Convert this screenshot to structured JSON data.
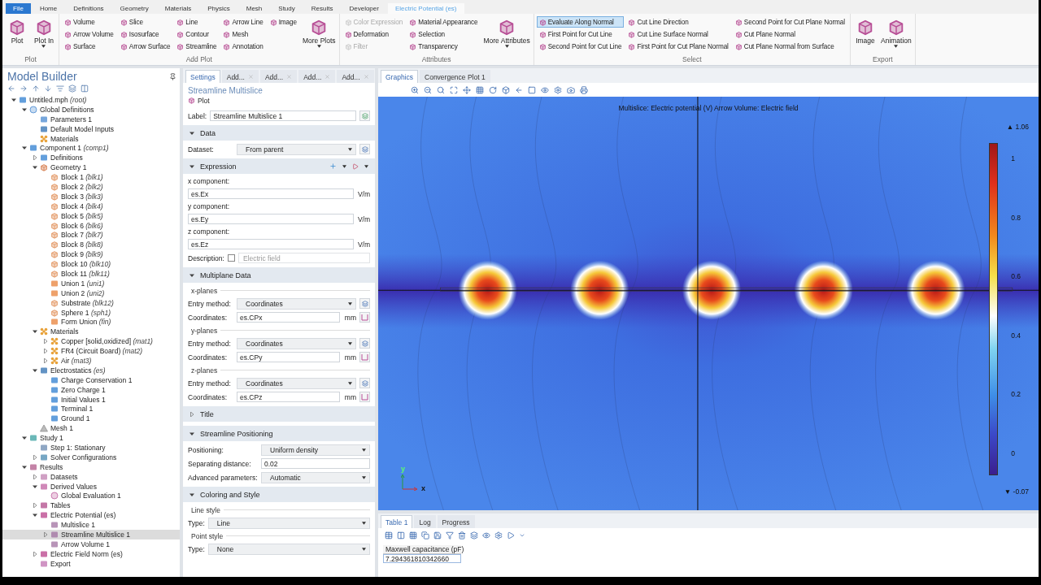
{
  "menu_tabs": [
    {
      "label": "File",
      "kind": "file"
    },
    {
      "label": "Home",
      "kind": "tab",
      "selected": false
    },
    {
      "label": "Definitions",
      "kind": "tab",
      "selected": false
    },
    {
      "label": "Geometry",
      "kind": "tab",
      "selected": false
    },
    {
      "label": "Materials",
      "kind": "tab",
      "selected": false
    },
    {
      "label": "Physics",
      "kind": "tab",
      "selected": false
    },
    {
      "label": "Mesh",
      "kind": "tab",
      "selected": false
    },
    {
      "label": "Study",
      "kind": "tab",
      "selected": false
    },
    {
      "label": "Results",
      "kind": "tab",
      "selected": false
    },
    {
      "label": "Developer",
      "kind": "tab",
      "selected": false
    },
    {
      "label": "Electric Potential (es)",
      "kind": "tab",
      "selected": true
    }
  ],
  "ribbon": [
    {
      "title": "Plot",
      "items": [
        {
          "label": "Plot",
          "kind": "large"
        },
        {
          "label": "Plot In",
          "kind": "large",
          "dropdown": true
        }
      ]
    },
    {
      "title": "Add Plot",
      "items": [
        {
          "label": "Volume",
          "kind": "small"
        },
        {
          "label": "Arrow Volume",
          "kind": "small"
        },
        {
          "label": "Surface",
          "kind": "small"
        },
        {
          "label": "Slice",
          "kind": "small"
        },
        {
          "label": "Isosurface",
          "kind": "small"
        },
        {
          "label": "Arrow Surface",
          "kind": "small"
        },
        {
          "label": "Line",
          "kind": "small"
        },
        {
          "label": "Contour",
          "kind": "small"
        },
        {
          "label": "Streamline",
          "kind": "small"
        },
        {
          "label": "Arrow Line",
          "kind": "small"
        },
        {
          "label": "Mesh",
          "kind": "small"
        },
        {
          "label": "Annotation",
          "kind": "small"
        },
        {
          "label": "Image",
          "kind": "small"
        },
        {
          "label": "More Plots",
          "kind": "large",
          "dropdown": true
        }
      ]
    },
    {
      "title": "Attributes",
      "items": [
        {
          "label": "Color Expression",
          "kind": "small",
          "disabled": true
        },
        {
          "label": "Deformation",
          "kind": "small"
        },
        {
          "label": "Filter",
          "kind": "small",
          "disabled": true
        },
        {
          "label": "Material Appearance",
          "kind": "small"
        },
        {
          "label": "Selection",
          "kind": "small"
        },
        {
          "label": "Transparency",
          "kind": "small"
        },
        {
          "label": "More Attributes",
          "kind": "large",
          "dropdown": true
        }
      ]
    },
    {
      "title": "Select",
      "items": [
        {
          "label": "Evaluate Along Normal",
          "kind": "small",
          "selected": true
        },
        {
          "label": "First Point for Cut Line",
          "kind": "small"
        },
        {
          "label": "Second Point for Cut Line",
          "kind": "small"
        },
        {
          "label": "Cut Line Direction",
          "kind": "small"
        },
        {
          "label": "Cut Line Surface Normal",
          "kind": "small"
        },
        {
          "label": "First Point for Cut Plane Normal",
          "kind": "small"
        },
        {
          "label": "Second Point for Cut Plane Normal",
          "kind": "small"
        },
        {
          "label": "Cut Plane Normal",
          "kind": "small"
        },
        {
          "label": "Cut Plane Normal from Surface",
          "kind": "small"
        }
      ]
    },
    {
      "title": "Export",
      "items": [
        {
          "label": "Image",
          "kind": "large"
        },
        {
          "label": "Animation",
          "kind": "large",
          "dropdown": true
        }
      ]
    }
  ],
  "model_builder": {
    "title": "Model Builder",
    "tree": [
      {
        "label": "Untitled.mph",
        "tag": "(root)",
        "kind": "file",
        "expanded": true,
        "selected": false,
        "children": [
          {
            "label": "Global Definitions",
            "kind": "global",
            "expanded": true,
            "selected": false,
            "children": [
              {
                "label": "Parameters 1",
                "kind": "param",
                "selected": false
              },
              {
                "label": "Default Model Inputs",
                "kind": "inputs",
                "selected": false
              },
              {
                "label": "Materials",
                "kind": "material",
                "selected": false
              }
            ]
          },
          {
            "label": "Component 1",
            "tag": "(comp1)",
            "kind": "component",
            "expanded": true,
            "selected": false,
            "children": [
              {
                "label": "Definitions",
                "kind": "definitions",
                "expanded": false,
                "selected": false
              },
              {
                "label": "Geometry 1",
                "kind": "geometry",
                "expanded": true,
                "selected": false,
                "children": [
                  {
                    "label": "Block 1",
                    "tag": "(blk1)",
                    "kind": "block",
                    "selected": false
                  },
                  {
                    "label": "Block 2",
                    "tag": "(blk2)",
                    "kind": "block",
                    "selected": false
                  },
                  {
                    "label": "Block 3",
                    "tag": "(blk3)",
                    "kind": "block",
                    "selected": false
                  },
                  {
                    "label": "Block 4",
                    "tag": "(blk4)",
                    "kind": "block",
                    "selected": false
                  },
                  {
                    "label": "Block 5",
                    "tag": "(blk5)",
                    "kind": "block",
                    "selected": false
                  },
                  {
                    "label": "Block 6",
                    "tag": "(blk6)",
                    "kind": "block",
                    "selected": false
                  },
                  {
                    "label": "Block 7",
                    "tag": "(blk7)",
                    "kind": "block",
                    "selected": false
                  },
                  {
                    "label": "Block 8",
                    "tag": "(blk8)",
                    "kind": "block",
                    "selected": false
                  },
                  {
                    "label": "Block 9",
                    "tag": "(blk9)",
                    "kind": "block",
                    "selected": false
                  },
                  {
                    "label": "Block 10",
                    "tag": "(blk10)",
                    "kind": "block",
                    "selected": false
                  },
                  {
                    "label": "Block 11",
                    "tag": "(blk11)",
                    "kind": "block",
                    "selected": false
                  },
                  {
                    "label": "Union 1",
                    "tag": "(uni1)",
                    "kind": "union",
                    "selected": false
                  },
                  {
                    "label": "Union 2",
                    "tag": "(uni2)",
                    "kind": "union",
                    "selected": false
                  },
                  {
                    "label": "Substrate",
                    "tag": "(blk12)",
                    "kind": "block",
                    "selected": false
                  },
                  {
                    "label": "Sphere 1",
                    "tag": "(sph1)",
                    "kind": "sphere",
                    "selected": false
                  },
                  {
                    "label": "Form Union",
                    "tag": "(fin)",
                    "kind": "union",
                    "selected": false
                  }
                ]
              },
              {
                "label": "Materials",
                "kind": "material",
                "expanded": true,
                "selected": false,
                "children": [
                  {
                    "label": "Copper [solid,oxidized]",
                    "tag": "(mat1)",
                    "kind": "material",
                    "expanded": false,
                    "selected": false
                  },
                  {
                    "label": "FR4 (Circuit Board)",
                    "tag": "(mat2)",
                    "kind": "material",
                    "expanded": false,
                    "selected": false
                  },
                  {
                    "label": "Air",
                    "tag": "(mat3)",
                    "kind": "material",
                    "expanded": false,
                    "selected": false
                  }
                ]
              },
              {
                "label": "Electrostatics",
                "tag": "(es)",
                "kind": "physics",
                "expanded": true,
                "selected": false,
                "children": [
                  {
                    "label": "Charge Conservation 1",
                    "kind": "feature",
                    "selected": false
                  },
                  {
                    "label": "Zero Charge 1",
                    "kind": "feature",
                    "selected": false
                  },
                  {
                    "label": "Initial Values 1",
                    "kind": "feature",
                    "selected": false
                  },
                  {
                    "label": "Terminal 1",
                    "kind": "feature",
                    "selected": false
                  },
                  {
                    "label": "Ground 1",
                    "kind": "feature",
                    "selected": false
                  }
                ]
              },
              {
                "label": "Mesh 1",
                "kind": "mesh",
                "selected": false
              }
            ]
          },
          {
            "label": "Study 1",
            "kind": "study",
            "expanded": true,
            "selected": false,
            "children": [
              {
                "label": "Step 1: Stationary",
                "kind": "step",
                "selected": false
              },
              {
                "label": "Solver Configurations",
                "kind": "solver",
                "expanded": false,
                "selected": false
              }
            ]
          },
          {
            "label": "Results",
            "kind": "results",
            "expanded": true,
            "selected": false,
            "children": [
              {
                "label": "Datasets",
                "kind": "dataset",
                "expanded": false,
                "selected": false
              },
              {
                "label": "Derived Values",
                "kind": "derived",
                "expanded": true,
                "selected": false,
                "children": [
                  {
                    "label": "Global Evaluation 1",
                    "kind": "eval",
                    "selected": false
                  }
                ]
              },
              {
                "label": "Tables",
                "kind": "table",
                "expanded": false,
                "selected": false
              },
              {
                "label": "Electric Potential (es)",
                "kind": "plotgroup",
                "expanded": true,
                "selected": false,
                "children": [
                  {
                    "label": "Multislice 1",
                    "kind": "plot",
                    "selected": false
                  },
                  {
                    "label": "Streamline Multislice 1",
                    "kind": "plot",
                    "expanded": false,
                    "selected": true
                  },
                  {
                    "label": "Arrow Volume 1",
                    "kind": "plot",
                    "selected": false
                  }
                ]
              },
              {
                "label": "Electric Field Norm (es)",
                "kind": "plotgroup",
                "expanded": false,
                "selected": false
              },
              {
                "label": "Export",
                "kind": "export",
                "selected": false
              }
            ]
          }
        ]
      }
    ]
  },
  "settings": {
    "tabs": [
      {
        "label": "Settings",
        "closable": false,
        "selected": true
      },
      {
        "label": "Add...",
        "closable": true,
        "selected": false
      },
      {
        "label": "Add...",
        "closable": true,
        "selected": false
      },
      {
        "label": "Add...",
        "closable": true,
        "selected": false
      },
      {
        "label": "Add...",
        "closable": true,
        "selected": false
      }
    ],
    "title": "Streamline Multislice",
    "subtitle": "Plot",
    "label_field": {
      "label": "Label:",
      "value": "Streamline Multislice 1"
    },
    "sections": [
      {
        "title": "Data",
        "expanded": true,
        "rows": [
          {
            "kind": "select",
            "label": "Dataset:",
            "value": "From parent"
          }
        ]
      },
      {
        "title": "Expression",
        "expanded": true,
        "rows": [
          {
            "kind": "stacked",
            "label": "x component:",
            "value": "es.Ex",
            "unit": "V/m"
          },
          {
            "kind": "stacked",
            "label": "y component:",
            "value": "es.Ey",
            "unit": "V/m"
          },
          {
            "kind": "stacked",
            "label": "z component:",
            "value": "es.Ez",
            "unit": "V/m"
          },
          {
            "kind": "checkbox",
            "label": "Description:",
            "checked": false,
            "placeholder": "Electric field"
          }
        ]
      },
      {
        "title": "Multiplane Data",
        "expanded": true,
        "rows": [
          {
            "kind": "group",
            "label": "x-planes"
          },
          {
            "kind": "select",
            "label": "Entry method:",
            "value": "Coordinates"
          },
          {
            "kind": "input",
            "label": "Coordinates:",
            "value": "es.CPx",
            "unit": "mm"
          },
          {
            "kind": "group",
            "label": "y-planes"
          },
          {
            "kind": "select",
            "label": "Entry method:",
            "value": "Coordinates"
          },
          {
            "kind": "input",
            "label": "Coordinates:",
            "value": "es.CPy",
            "unit": "mm"
          },
          {
            "kind": "group",
            "label": "z-planes"
          },
          {
            "kind": "select",
            "label": "Entry method:",
            "value": "Coordinates"
          },
          {
            "kind": "input",
            "label": "Coordinates:",
            "value": "es.CPz",
            "unit": "mm"
          }
        ]
      },
      {
        "title": "Title",
        "expanded": false
      },
      {
        "title": "Streamline Positioning",
        "expanded": true,
        "rows": [
          {
            "kind": "select",
            "label": "Positioning:",
            "value": "Uniform density",
            "wide": true
          },
          {
            "kind": "input",
            "label": "Separating distance:",
            "value": "0.02",
            "wide": true
          },
          {
            "kind": "select",
            "label": "Advanced parameters:",
            "value": "Automatic",
            "wide": true
          }
        ]
      },
      {
        "title": "Coloring and Style",
        "expanded": true,
        "rows": [
          {
            "kind": "group",
            "label": "Line style"
          },
          {
            "kind": "select",
            "label": "Type:",
            "value": "Line",
            "narrow": true
          },
          {
            "kind": "group",
            "label": "Point style"
          },
          {
            "kind": "select",
            "label": "Type:",
            "value": "None",
            "narrow": true
          }
        ]
      }
    ]
  },
  "graphics": {
    "tabs": [
      {
        "label": "Graphics",
        "selected": true
      },
      {
        "label": "Convergence Plot 1",
        "selected": false
      }
    ],
    "plot_title": "Multislice: Electric potential (V)  Arrow Volume: Electric field",
    "colorbar": {
      "max_label": "▲ 1.06",
      "min_label": "▼ -0.07",
      "ticks": [
        "1",
        "0.8",
        "0.6",
        "0.4",
        "0.2",
        "0"
      ]
    },
    "axes": {
      "x": "x",
      "y": "y"
    }
  },
  "results": {
    "tabs": [
      {
        "label": "Table 1",
        "selected": true
      },
      {
        "label": "Log",
        "selected": false
      },
      {
        "label": "Progress",
        "selected": false
      }
    ],
    "columns": [
      "Maxwell capacitance (pF)"
    ],
    "rows": [
      [
        "7.294361810342660"
      ]
    ]
  }
}
